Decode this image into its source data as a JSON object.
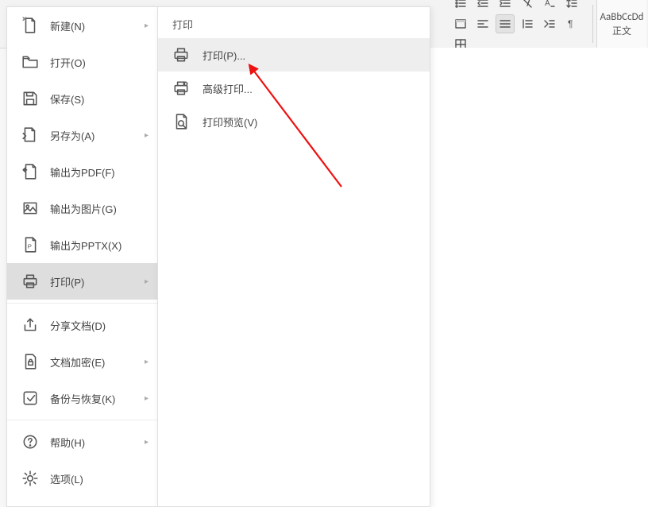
{
  "toolbar": {
    "style_sample": "AaBbCcDd",
    "style_name": "正文"
  },
  "file_menu": {
    "items": [
      {
        "label": "新建(N)",
        "has_sub": true
      },
      {
        "label": "打开(O)",
        "has_sub": false
      },
      {
        "label": "保存(S)",
        "has_sub": false
      },
      {
        "label": "另存为(A)",
        "has_sub": true
      },
      {
        "label": "输出为PDF(F)",
        "has_sub": false
      },
      {
        "label": "输出为图片(G)",
        "has_sub": false
      },
      {
        "label": "输出为PPTX(X)",
        "has_sub": false
      },
      {
        "label": "打印(P)",
        "has_sub": true,
        "selected": true
      },
      {
        "label": "分享文档(D)",
        "has_sub": false
      },
      {
        "label": "文档加密(E)",
        "has_sub": true
      },
      {
        "label": "备份与恢复(K)",
        "has_sub": true
      },
      {
        "label": "帮助(H)",
        "has_sub": true
      },
      {
        "label": "选项(L)",
        "has_sub": false
      }
    ]
  },
  "print_submenu": {
    "header": "打印",
    "items": [
      {
        "label": "打印(P)...",
        "hover": true
      },
      {
        "label": "高级打印...",
        "hover": false
      },
      {
        "label": "打印预览(V)",
        "hover": false
      }
    ]
  }
}
